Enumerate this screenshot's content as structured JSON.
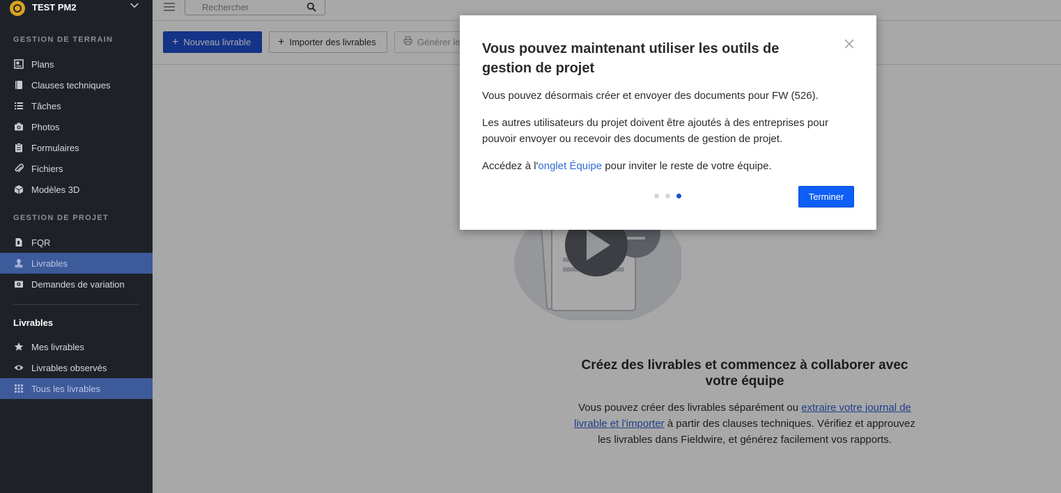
{
  "project": {
    "name": "TEST PM2"
  },
  "sidebar": {
    "section_field": "GESTION DE TERRAIN",
    "field_items": [
      {
        "label": "Plans"
      },
      {
        "label": "Clauses techniques"
      },
      {
        "label": "Tâches"
      },
      {
        "label": "Photos"
      },
      {
        "label": "Formulaires"
      },
      {
        "label": "Fichiers"
      },
      {
        "label": "Modèles 3D"
      }
    ],
    "section_project": "GESTION DE PROJET",
    "project_items": [
      {
        "label": "FQR"
      },
      {
        "label": "Livrables"
      },
      {
        "label": "Demandes de variation"
      }
    ],
    "subsection_title": "Livrables",
    "sub_items": [
      {
        "label": "Mes livrables"
      },
      {
        "label": "Livrables observés"
      },
      {
        "label": "Tous les livrables"
      }
    ],
    "active_color": "#3d5a9a"
  },
  "topbar": {
    "search_placeholder": "Rechercher"
  },
  "toolbar": {
    "new_label": "Nouveau livrable",
    "import_label": "Importer des livrables",
    "generate_label": "Générer le"
  },
  "empty_state": {
    "title": "Créez des livrables et commencez à collaborer avec votre équipe",
    "desc_before": "Vous pouvez créer des livrables séparément ou ",
    "desc_link": "extraire votre journal de livrable et l'importer",
    "desc_after": " à partir des clauses techniques. Vérifiez et approuvez les livrables dans Fieldwire, et générez facilement vos rapports."
  },
  "modal": {
    "title": "Vous pouvez maintenant utiliser les outils de gestion de projet",
    "p1": "Vous pouvez désormais créer et envoyer des documents pour FW (526).",
    "p2": "Les autres utilisateurs du projet doivent être ajoutés à des entreprises pour pouvoir envoyer ou recevoir des documents de gestion de projet.",
    "p3_before": "Accédez à l'",
    "p3_link": "onglet Équipe",
    "p3_after": " pour inviter le reste de votre équipe.",
    "finish_label": "Terminer",
    "steps_total": 3,
    "step_current": 3
  },
  "colors": {
    "primary": "#1f4fd1",
    "finish_button": "#0d5ff5",
    "sidebar_bg": "#1e2228"
  }
}
